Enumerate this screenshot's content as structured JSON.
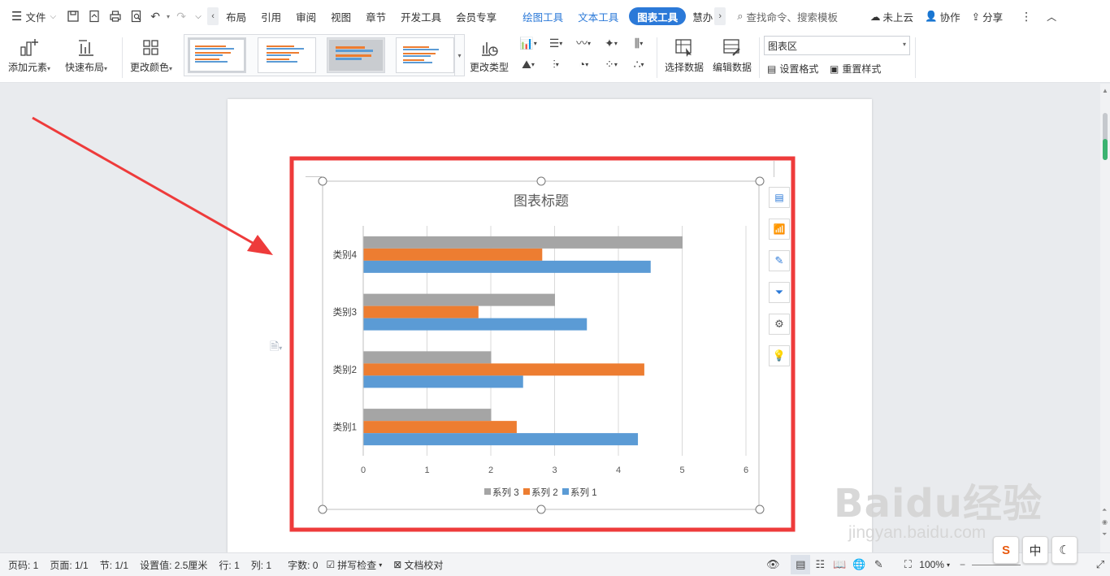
{
  "menubar": {
    "file": "文件",
    "tabs": [
      "布局",
      "引用",
      "审阅",
      "视图",
      "章节",
      "开发工具",
      "会员专享"
    ],
    "context_tabs": [
      "绘图工具",
      "文本工具"
    ],
    "active_tab": "图表工具",
    "overflow_tab": "慧办",
    "search_placeholder": "查找命令、搜索模板",
    "cloud": "未上云",
    "collab": "协作",
    "share": "分享"
  },
  "ribbon": {
    "add_element": "添加元素",
    "quick_layout": "快速布局",
    "change_color": "更改颜色",
    "change_type": "更改类型",
    "select_data": "选择数据",
    "edit_data": "编辑数据",
    "chart_area_value": "图表区",
    "set_format": "设置格式",
    "reset_style": "重置样式"
  },
  "chart_data": {
    "type": "bar",
    "orientation": "horizontal",
    "title": "图表标题",
    "categories": [
      "类别1",
      "类别2",
      "类别3",
      "类别4"
    ],
    "series": [
      {
        "name": "系列 1",
        "color": "#5b9bd5",
        "values": [
          4.3,
          2.5,
          3.5,
          4.5
        ]
      },
      {
        "name": "系列 2",
        "color": "#ed7d31",
        "values": [
          2.4,
          4.4,
          1.8,
          2.8
        ]
      },
      {
        "name": "系列 3",
        "color": "#a5a5a5",
        "values": [
          2,
          2,
          3,
          5
        ]
      }
    ],
    "xlim": [
      0,
      6
    ],
    "xticks": [
      "0",
      "1",
      "2",
      "3",
      "4",
      "5",
      "6"
    ],
    "grid": true,
    "legend": "bottom"
  },
  "colors": {
    "accent": "#2b79d8",
    "highlight_box": "#ee3b3b",
    "arrow": "#ee3b3b"
  },
  "statusbar": {
    "page_no": "页码: 1",
    "pages": "页面: 1/1",
    "section": "节: 1/1",
    "setting": "设置值: 2.5厘米",
    "row": "行: 1",
    "col": "列: 1",
    "words": "字数: 0",
    "spell": "拼写检查",
    "proof": "文档校对",
    "zoom": "100%"
  },
  "watermark": {
    "brand": "Baidu经验",
    "url": "jingyan.baidu.com"
  },
  "ime": {
    "lang": "中"
  }
}
